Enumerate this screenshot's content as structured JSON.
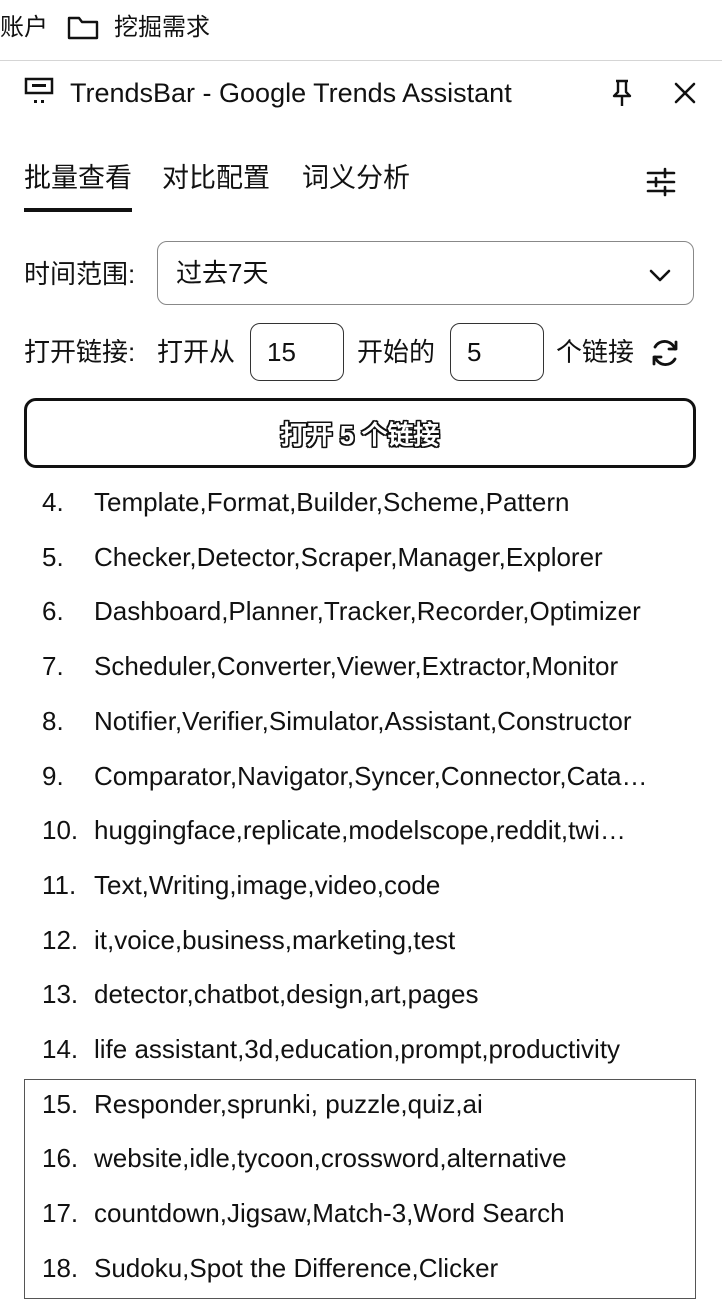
{
  "topbar": {
    "account_fragment": "账户",
    "folder_label": "挖掘需求"
  },
  "header": {
    "title": "TrendsBar - Google Trends Assistant"
  },
  "tabs": [
    {
      "label": "批量查看"
    },
    {
      "label": "对比配置"
    },
    {
      "label": "词义分析"
    }
  ],
  "time_range": {
    "label": "时间范围:",
    "value": "过去7天"
  },
  "open_links": {
    "label": "打开链接:",
    "prefix": "打开从",
    "start": "15",
    "middle": "开始的",
    "count": "5",
    "suffix": "个链接"
  },
  "open_button": {
    "label": "打开 5 个链接"
  },
  "keywords": [
    {
      "num": "4.",
      "text": "Template,Format,Builder,Scheme,Pattern"
    },
    {
      "num": "5.",
      "text": "Checker,Detector,Scraper,Manager,Explorer"
    },
    {
      "num": "6.",
      "text": "Dashboard,Planner,Tracker,Recorder,Optimizer"
    },
    {
      "num": "7.",
      "text": "Scheduler,Converter,Viewer,Extractor,Monitor"
    },
    {
      "num": "8.",
      "text": "Notifier,Verifier,Simulator,Assistant,Constructor"
    },
    {
      "num": "9.",
      "text": "Comparator,Navigator,Syncer,Connector,Cata…"
    },
    {
      "num": "10.",
      "text": "huggingface,replicate,modelscope,reddit,twi…"
    },
    {
      "num": "11.",
      "text": "Text,Writing,image,video,code"
    },
    {
      "num": "12.",
      "text": "it,voice,business,marketing,test"
    },
    {
      "num": "13.",
      "text": "detector,chatbot,design,art,pages"
    },
    {
      "num": "14.",
      "text": "life assistant,3d,education,prompt,productivity"
    },
    {
      "num": "15.",
      "text": "Responder,sprunki, puzzle,quiz,ai"
    },
    {
      "num": "16.",
      "text": "website,idle,tycoon,crossword,alternative"
    },
    {
      "num": "17.",
      "text": "countdown,Jigsaw,Match-3,Word Search"
    },
    {
      "num": "18.",
      "text": "Sudoku,Spot the Difference,Clicker"
    }
  ]
}
